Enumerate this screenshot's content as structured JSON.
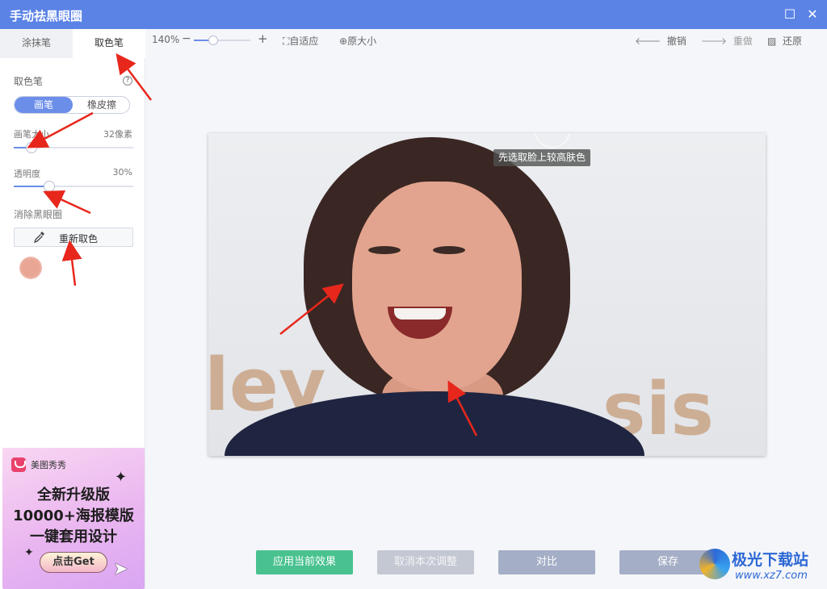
{
  "window": {
    "title": "手动祛黑眼圈",
    "maximize_icon": "maximize-icon",
    "close_icon": "close-icon"
  },
  "sidebar": {
    "tabs": [
      {
        "label": "涂抹笔",
        "active": false
      },
      {
        "label": "取色笔",
        "active": true
      }
    ],
    "section_title": "取色笔",
    "help_label": "?",
    "mode": {
      "options": [
        "画笔",
        "橡皮擦"
      ],
      "selected": "画笔"
    },
    "brush_size": {
      "label": "画笔大小",
      "value_text": "32像素",
      "level": 0.15
    },
    "opacity": {
      "label": "透明度",
      "value_text": "30%",
      "level": 0.3
    },
    "remove_section": "消除黑眼圈",
    "recolor_button": "重新取色",
    "picked_color": "#e9a694"
  },
  "ad": {
    "brand": "美图秀秀",
    "lines": [
      "全新升级版",
      "10000+海报模版",
      "一键套用设计"
    ],
    "cta": "点击Get"
  },
  "toolbar": {
    "zoom_text": "140%",
    "zoom_minus": "−",
    "zoom_plus": "+",
    "fit_label": "自适应",
    "original_size_label": "原大小",
    "undo_label": "撤销",
    "redo_label": "重做",
    "restore_label": "还原"
  },
  "canvas": {
    "tooltip": "先选取脸上较高肤色",
    "bg_letters": [
      "ley",
      "sis",
      "y"
    ]
  },
  "actions": {
    "apply": "应用当前效果",
    "cancel": "取消本次调整",
    "compare": "对比",
    "save": "保存"
  },
  "watermark": {
    "title": "极光下载站",
    "url": "www.xz7.com"
  },
  "colors": {
    "titlebar": "#5b83e6",
    "accent": "#6b8ee9",
    "apply_button": "#49c28f",
    "annotation_arrow": "#e8271c"
  }
}
